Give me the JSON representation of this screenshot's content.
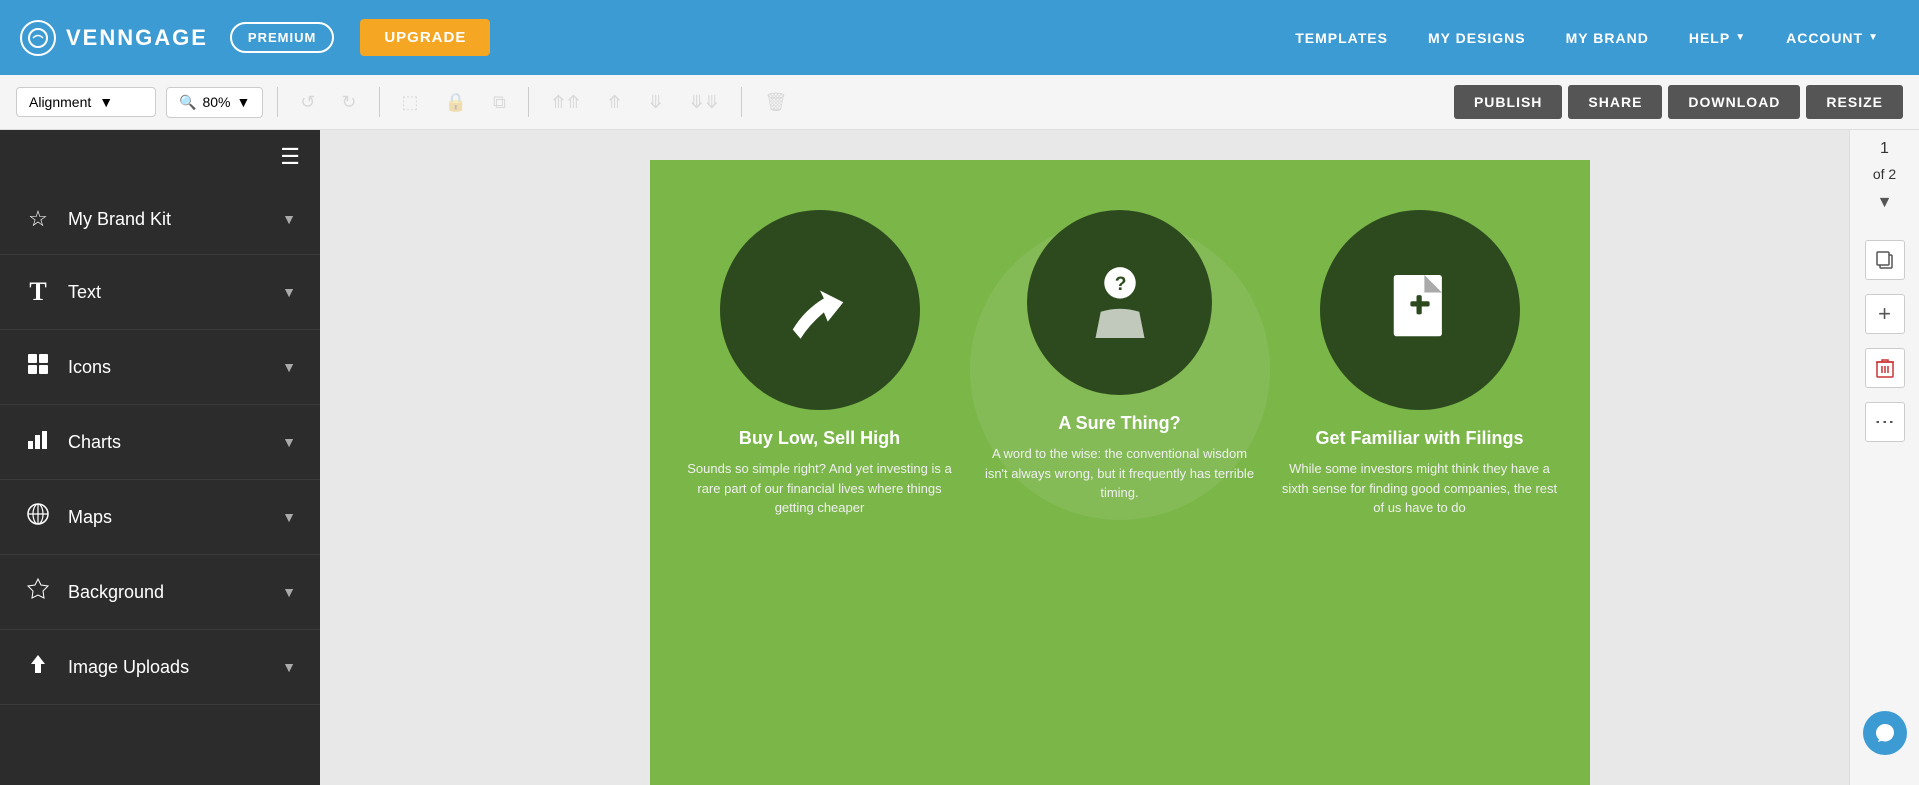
{
  "topnav": {
    "logo_text": "VENNGAGE",
    "premium_label": "PREMIUM",
    "upgrade_label": "UPGRADE",
    "links": [
      {
        "id": "templates",
        "label": "TEMPLATES",
        "arrow": false
      },
      {
        "id": "my-designs",
        "label": "MY DESIGNS",
        "arrow": false
      },
      {
        "id": "my-brand",
        "label": "MY BRAND",
        "arrow": false
      },
      {
        "id": "help",
        "label": "HELP",
        "arrow": true
      },
      {
        "id": "account",
        "label": "ACCOUNT",
        "arrow": true
      }
    ]
  },
  "toolbar": {
    "alignment_label": "Alignment",
    "zoom_label": "80%",
    "publish_label": "PUBLISH",
    "share_label": "SHARE",
    "download_label": "DOWNLOAD",
    "resize_label": "RESIZE"
  },
  "sidebar": {
    "items": [
      {
        "id": "my-brand-kit",
        "label": "My Brand Kit",
        "icon": "⭐"
      },
      {
        "id": "text",
        "label": "Text",
        "icon": "T"
      },
      {
        "id": "icons",
        "label": "Icons",
        "icon": "⊞"
      },
      {
        "id": "charts",
        "label": "Charts",
        "icon": "📊"
      },
      {
        "id": "maps",
        "label": "Maps",
        "icon": "🌐"
      },
      {
        "id": "background",
        "label": "Background",
        "icon": "◈"
      },
      {
        "id": "image-uploads",
        "label": "Image Uploads",
        "icon": "⬆"
      }
    ]
  },
  "page_indicator": {
    "current": "1",
    "of_label": "of 2"
  },
  "canvas": {
    "background_color": "#7ab648",
    "circles": [
      {
        "id": "buy-low",
        "title": "Buy Low, Sell High",
        "description": "Sounds so simple right? And yet investing is a rare part of our financial lives where things getting cheaper",
        "icon_type": "arrow"
      },
      {
        "id": "sure-thing",
        "title": "A Sure Thing?",
        "description": "A word to the wise: the conventional wisdom isn't always wrong, but it frequently has terrible timing.",
        "icon_type": "question"
      },
      {
        "id": "filings",
        "title": "Get Familiar with Filings",
        "description": "While some investors might think they have a sixth sense for finding good companies, the rest of us have to do",
        "icon_type": "document"
      }
    ]
  }
}
